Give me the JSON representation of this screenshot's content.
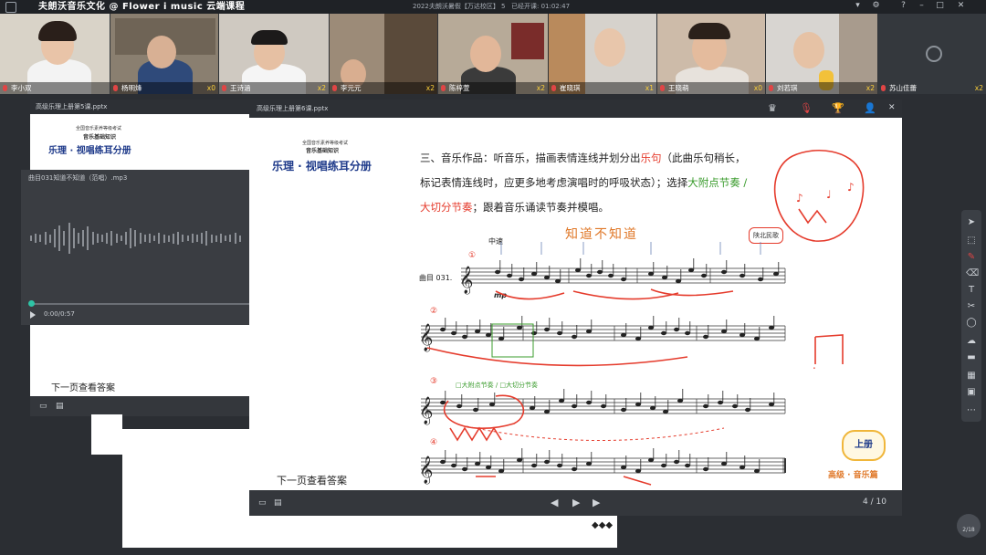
{
  "titlebar": {
    "brand": "夫朗沃音乐文化 @ Flower  i music 云端课程",
    "course": "2022夫朗沃暑假【万达校区】 5",
    "timer": "已经开课: 01:02:47"
  },
  "participants": [
    {
      "name": "李小双",
      "trophy": ""
    },
    {
      "name": "杨明烽",
      "trophy": "x0"
    },
    {
      "name": "王诗涵",
      "trophy": "x2"
    },
    {
      "name": "李元元",
      "trophy": "x2"
    },
    {
      "name": "陈梓萱",
      "trophy": "x2"
    },
    {
      "name": "崔晓琪",
      "trophy": "x1"
    },
    {
      "name": "王晓萌",
      "trophy": "x0"
    },
    {
      "name": "刘若琪",
      "trophy": "x2"
    },
    {
      "name": "苏山佳蕾",
      "trophy": "x2"
    }
  ],
  "window_a": {
    "title": "高级乐理上册第5课.pptx",
    "hint": "下一页查看答案"
  },
  "audio": {
    "file": "曲目031知道不知道（范唱）.mp3",
    "time": "0:00/0:57"
  },
  "main_window": {
    "title": "高级乐理上册第6课.pptx",
    "page": "4",
    "total": "10"
  },
  "slide": {
    "logo_small": "全国音乐素养等级考试",
    "logo_sub": "音乐基础知识",
    "logo_title": "乐理 · 视唱练耳分册",
    "instr1_a": "三、音乐作品：听音乐，描画表情连线并划分出",
    "instr1_b": "乐句",
    "instr1_c": "（此曲乐句稍长，",
    "instr2": "标记表情连线时，应更多地考虑演唱时的呼吸状态）；选择",
    "instr2_b": "大附点节奏 /",
    "instr3_a": "大切分节奏",
    "instr3_b": "；跟着音乐诵读节奏并模唱。",
    "song_title": "知道不知道",
    "genre": "陕北民歌",
    "tempo": "中速",
    "piece": "曲目 031.",
    "dynamic": "mp",
    "rhythm_choice": "□大附点节奏 / □大切分节奏",
    "next_hint": "下一页查看答案",
    "badge": "上册",
    "series": "高级 · 音乐篇",
    "lines": [
      "①",
      "②",
      "③",
      "④"
    ]
  },
  "corner": {
    "page": "2/18"
  },
  "colors": {
    "accent_red": "#e53b2c",
    "accent_green": "#3b9c2e",
    "accent_orange": "#e0792a"
  }
}
